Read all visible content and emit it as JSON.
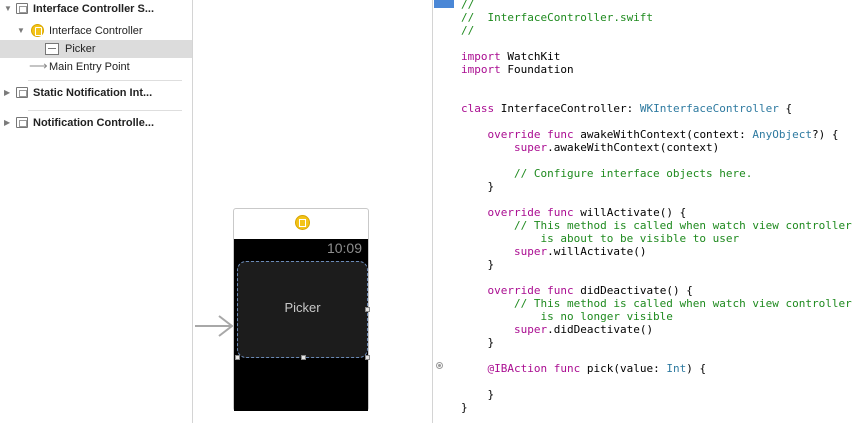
{
  "outline": {
    "scene1": {
      "label": "Interface Controller S..."
    },
    "interface_controller": {
      "label": "Interface Controller"
    },
    "picker": {
      "label": "Picker"
    },
    "main_entry": {
      "label": "Main Entry Point"
    },
    "scene2": {
      "label": "Static Notification Int..."
    },
    "scene3": {
      "label": "Notification Controlle..."
    }
  },
  "canvas": {
    "time": "10:09",
    "picker_label": "Picker"
  },
  "code": {
    "lines": [
      "//",
      "//  InterfaceController.swift",
      "//",
      "",
      "import WatchKit",
      "import Foundation",
      "",
      "",
      "class InterfaceController: WKInterfaceController {",
      "",
      "    override func awakeWithContext(context: AnyObject?) {",
      "        super.awakeWithContext(context)",
      "",
      "        // Configure interface objects here.",
      "    }",
      "",
      "    override func willActivate() {",
      "        // This method is called when watch view controller",
      "            is about to be visible to user",
      "        super.willActivate()",
      "    }",
      "",
      "    override func didDeactivate() {",
      "        // This method is called when watch view controller",
      "            is no longer visible",
      "        super.didDeactivate()",
      "    }",
      "",
      "    @IBAction func pick(value: Int) {",
      "",
      "    }",
      "}"
    ]
  },
  "colors": {
    "keyword": "#aa0d91",
    "comment": "#1e8a1e",
    "type": "#2e7aa0",
    "selection": "#dcdcdc",
    "accent": "#4a87d6"
  }
}
